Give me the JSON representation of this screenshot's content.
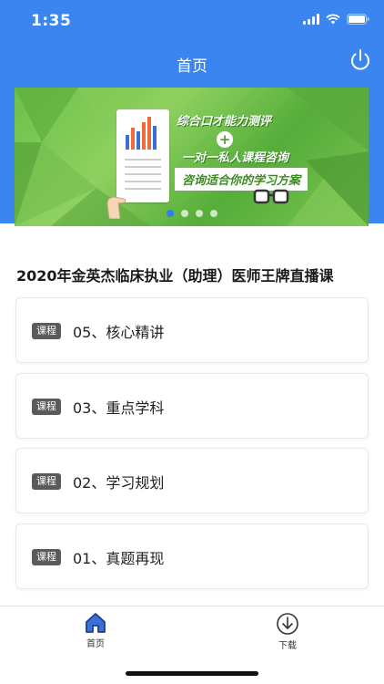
{
  "status_bar": {
    "time": "1:35"
  },
  "nav": {
    "title": "首页"
  },
  "banner": {
    "line1": "综合口才能力测评",
    "plus": "+",
    "line2": "一对一私人课程咨询",
    "line3": "咨询适合你的学习方案",
    "dot_count": 4,
    "active_dot": 0
  },
  "section": {
    "title": "2020年金英杰临床执业（助理）医师王牌直播课"
  },
  "courses": [
    {
      "tag": "课程",
      "title": "05、核心精讲"
    },
    {
      "tag": "课程",
      "title": "03、重点学科"
    },
    {
      "tag": "课程",
      "title": "02、学习规划"
    },
    {
      "tag": "课程",
      "title": "01、真题再现"
    }
  ],
  "tabbar": {
    "items": [
      {
        "label": "首页",
        "icon": "home-icon",
        "active": true
      },
      {
        "label": "下载",
        "icon": "download-icon",
        "active": false
      }
    ]
  },
  "colors": {
    "primary": "#3a85f0",
    "banner_green": "#6cc04a",
    "tag_bg": "#5a5a5a"
  }
}
